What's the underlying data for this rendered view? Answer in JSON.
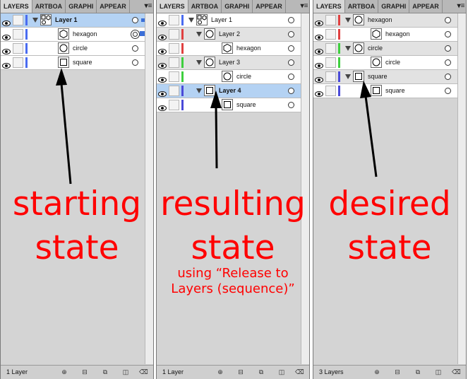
{
  "panels": [
    {
      "tabs": [
        "LAYERS",
        "ARTBOA",
        "GRAPHI",
        "APPEAR"
      ],
      "rows": [
        {
          "label": "Layer 1",
          "level": 0,
          "bold": true,
          "expanded": true,
          "selected": true,
          "thumb": "group",
          "bar": "#4a6cf0",
          "target": "single",
          "selSquare": "small"
        },
        {
          "label": "hexagon",
          "level": 1,
          "bold": false,
          "selected": false,
          "thumb": "hexagon",
          "bar": "#4a6cf0",
          "target": "double",
          "selSquare": "big"
        },
        {
          "label": "circle",
          "level": 1,
          "bold": false,
          "selected": false,
          "thumb": "circle",
          "bar": "#4a6cf0",
          "target": "single"
        },
        {
          "label": "square",
          "level": 1,
          "bold": false,
          "selected": false,
          "thumb": "square",
          "bar": "#4a6cf0",
          "target": "single"
        }
      ],
      "footer": {
        "count": "1 Layer"
      }
    },
    {
      "tabs": [
        "LAYERS",
        "ARTBOA",
        "GRAPHI",
        "APPEAR"
      ],
      "rows": [
        {
          "label": "Layer 1",
          "level": 0,
          "bold": false,
          "expanded": true,
          "thumb": "group",
          "bar": "#4a6cf0",
          "target": "single"
        },
        {
          "label": "Layer 2",
          "level": 1,
          "bold": false,
          "expanded": true,
          "sublayer": true,
          "thumb": "circle",
          "bar": "#e04040",
          "target": "single"
        },
        {
          "label": "hexagon",
          "level": 2,
          "bold": false,
          "thumb": "hexagon",
          "bar": "#e04040",
          "target": "single"
        },
        {
          "label": "Layer 3",
          "level": 1,
          "bold": false,
          "expanded": true,
          "sublayer": true,
          "thumb": "circle",
          "bar": "#3ecf3e",
          "target": "single"
        },
        {
          "label": "circle",
          "level": 2,
          "bold": false,
          "thumb": "circle",
          "bar": "#3ecf3e",
          "target": "single"
        },
        {
          "label": "Layer 4",
          "level": 1,
          "bold": true,
          "expanded": true,
          "selected": true,
          "thumb": "square",
          "bar": "#4a4ad8",
          "target": "single"
        },
        {
          "label": "square",
          "level": 2,
          "bold": false,
          "thumb": "square",
          "bar": "#4a4ad8",
          "target": "single"
        }
      ],
      "footer": {
        "count": "1 Layer"
      }
    },
    {
      "tabs": [
        "LAYERS",
        "ARTBOA",
        "GRAPHI",
        "APPEAR"
      ],
      "rows": [
        {
          "label": "hexagon",
          "level": 0,
          "bold": false,
          "expanded": true,
          "sublayer": true,
          "thumb": "circle",
          "bar": "#e04040",
          "target": "single"
        },
        {
          "label": "hexagon",
          "level": 1,
          "bold": false,
          "thumb": "hexagon",
          "bar": "#e04040",
          "target": "single"
        },
        {
          "label": "circle",
          "level": 0,
          "bold": false,
          "expanded": true,
          "sublayer": true,
          "thumb": "circle",
          "bar": "#3ecf3e",
          "target": "single"
        },
        {
          "label": "circle",
          "level": 1,
          "bold": false,
          "thumb": "circle",
          "bar": "#3ecf3e",
          "target": "single"
        },
        {
          "label": "square",
          "level": 0,
          "bold": false,
          "expanded": true,
          "sublayer": true,
          "thumb": "square",
          "bar": "#4a4ad8",
          "target": "single"
        },
        {
          "label": "square",
          "level": 1,
          "bold": false,
          "thumb": "square",
          "bar": "#4a4ad8",
          "target": "single"
        }
      ],
      "footer": {
        "count": "3 Layers"
      }
    }
  ],
  "annotations": {
    "starting": [
      "starting",
      "state"
    ],
    "resulting": [
      "resulting",
      "state"
    ],
    "resulting_note": [
      "using “Release to",
      "Layers (sequence)”"
    ],
    "desired": [
      "desired",
      "state"
    ]
  },
  "colors": {
    "annotation": "#ff0000",
    "selection": "#b4d2f3"
  }
}
